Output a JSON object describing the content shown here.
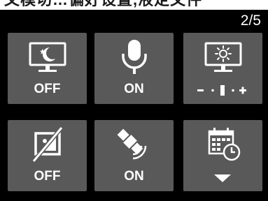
{
  "header": {
    "caption_text": "文模切…偏好设置,液定文件",
    "page_indicator": "2/5"
  },
  "tiles": [
    {
      "icon": "night-mode-monitor-icon",
      "status": "OFF"
    },
    {
      "icon": "microphone-icon",
      "status": "ON"
    },
    {
      "icon": "brightness-monitor-icon",
      "control": "brightness-slider",
      "slider_level": 0.5
    },
    {
      "icon": "display-disabled-icon",
      "status": "OFF"
    },
    {
      "icon": "satellite-gps-icon",
      "status": "ON"
    },
    {
      "icon": "calendar-clock-icon",
      "control": "expand-arrow"
    }
  ],
  "colors": {
    "screen_background": "#000000",
    "tile_background": "#595959",
    "foreground": "#ffffff"
  }
}
